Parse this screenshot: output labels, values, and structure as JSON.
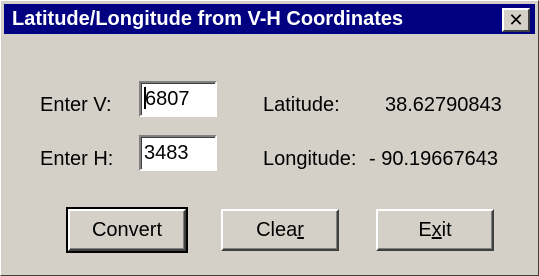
{
  "window": {
    "title": "Latitude/Longitude from V-H Coordinates",
    "close_glyph": "✕"
  },
  "inputs": {
    "v_label": "Enter  V:",
    "v_value": "6807",
    "h_label": "Enter  H:",
    "h_value": "3483"
  },
  "results": {
    "latitude_label": "Latitude:",
    "latitude_value": "38.62790843",
    "longitude_label": "Longitude:",
    "longitude_value": "- 90.19667643"
  },
  "buttons": {
    "convert": "Convert",
    "clear_prefix": "Clea",
    "clear_mnemonic": "r",
    "exit_prefix": "E",
    "exit_mnemonic": "x",
    "exit_suffix": "it"
  },
  "colors": {
    "titlebar": "#000080",
    "face": "#d4d0c8"
  }
}
